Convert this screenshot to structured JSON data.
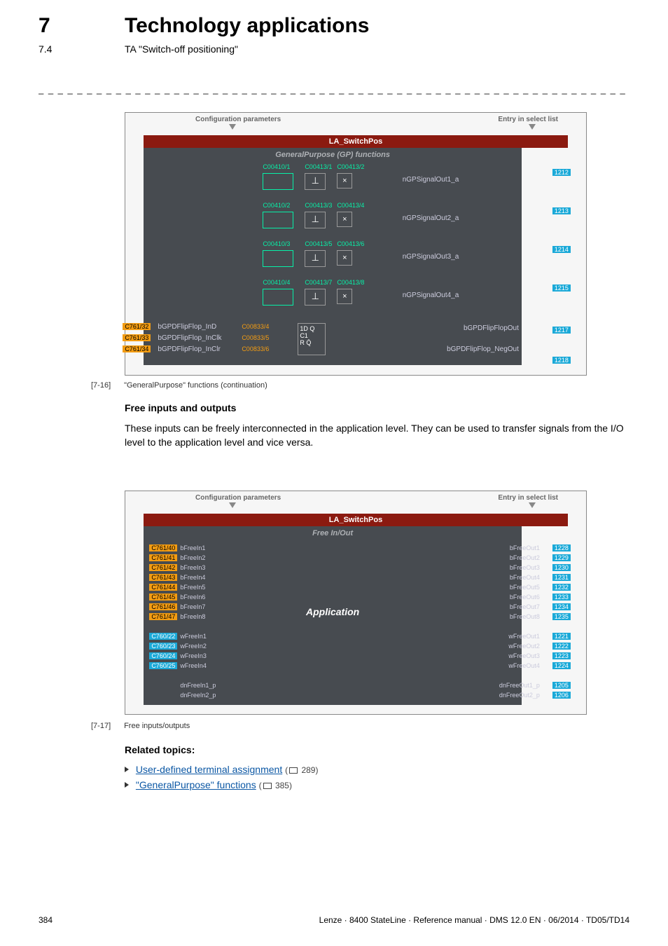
{
  "header": {
    "num": "7",
    "title": "Technology applications",
    "subnum": "7.4",
    "subtitle": "TA \"Switch-off positioning\""
  },
  "diag_common": {
    "cfg": "Configuration parameters",
    "entry": "Entry in select list",
    "la": "LA_SwitchPos"
  },
  "diag1": {
    "subheader": "GeneralPurpose (GP) functions",
    "rows": [
      {
        "c1": "C00410/1",
        "c2": "C00413/1",
        "c3": "C00413/2",
        "out": "nGPSignalOut1_a",
        "pin": "1212"
      },
      {
        "c1": "C00410/2",
        "c2": "C00413/3",
        "c3": "C00413/4",
        "out": "nGPSignalOut2_a",
        "pin": "1213"
      },
      {
        "c1": "C00410/3",
        "c2": "C00413/5",
        "c3": "C00413/6",
        "out": "nGPSignalOut3_a",
        "pin": "1214"
      },
      {
        "c1": "C00410/4",
        "c2": "C00413/7",
        "c3": "C00413/8",
        "out": "nGPSignalOut4_a",
        "pin": "1215"
      }
    ],
    "ff": {
      "in": [
        "bGPDFlipFlop_InD",
        "bGPDFlipFlop_InClk",
        "bGPDFlipFlop_InClr"
      ],
      "codes": [
        "C00833/4",
        "C00833/5",
        "C00833/6"
      ],
      "tags": [
        "C761/32",
        "C761/33",
        "C761/34"
      ],
      "box": [
        "1D  Q",
        "C1",
        "R   Q̄"
      ],
      "out": [
        "bGPDFlipFlopOut",
        "bGPDFlipFlop_NegOut"
      ],
      "pins": [
        "1217",
        "1218"
      ]
    }
  },
  "caption1": {
    "tag": "[7-16]",
    "text": "\"GeneralPurpose\" functions (continuation)"
  },
  "freeio": {
    "heading": "Free inputs and outputs",
    "para": "These inputs can be freely interconnected in the application level. They can be used to transfer signals from the I/O level to the application level and vice versa."
  },
  "diag2": {
    "subheader": "Free In/Out",
    "app": "Application",
    "bIn": [
      {
        "tag": "C761/40",
        "lbl": "bFreeIn1"
      },
      {
        "tag": "C761/41",
        "lbl": "bFreeIn2"
      },
      {
        "tag": "C761/42",
        "lbl": "bFreeIn3"
      },
      {
        "tag": "C761/43",
        "lbl": "bFreeIn4"
      },
      {
        "tag": "C761/44",
        "lbl": "bFreeIn5"
      },
      {
        "tag": "C761/45",
        "lbl": "bFreeIn6"
      },
      {
        "tag": "C761/46",
        "lbl": "bFreeIn7"
      },
      {
        "tag": "C761/47",
        "lbl": "bFreeIn8"
      }
    ],
    "wIn": [
      {
        "tag": "C760/22",
        "lbl": "wFreeIn1"
      },
      {
        "tag": "C760/23",
        "lbl": "wFreeIn2"
      },
      {
        "tag": "C760/24",
        "lbl": "wFreeIn3"
      },
      {
        "tag": "C760/25",
        "lbl": "wFreeIn4"
      }
    ],
    "dnIn": [
      {
        "lbl": "dnFreeIn1_p"
      },
      {
        "lbl": "dnFreeIn2_p"
      }
    ],
    "bOut": [
      {
        "lbl": "bFreeOut1",
        "pin": "1228"
      },
      {
        "lbl": "bFreeOut2",
        "pin": "1229"
      },
      {
        "lbl": "bFreeOut3",
        "pin": "1230"
      },
      {
        "lbl": "bFreeOut4",
        "pin": "1231"
      },
      {
        "lbl": "bFreeOut5",
        "pin": "1232"
      },
      {
        "lbl": "bFreeOut6",
        "pin": "1233"
      },
      {
        "lbl": "bFreeOut7",
        "pin": "1234"
      },
      {
        "lbl": "bFreeOut8",
        "pin": "1235"
      }
    ],
    "wOut": [
      {
        "lbl": "wFreeOut1",
        "pin": "1221"
      },
      {
        "lbl": "wFreeOut2",
        "pin": "1222"
      },
      {
        "lbl": "wFreeOut3",
        "pin": "1223"
      },
      {
        "lbl": "wFreeOut4",
        "pin": "1224"
      }
    ],
    "dnOut": [
      {
        "lbl": "dnFreeOut1_p",
        "pin": "1205"
      },
      {
        "lbl": "dnFreeOut2_p",
        "pin": "1206"
      }
    ]
  },
  "caption2": {
    "tag": "[7-17]",
    "text": "Free inputs/outputs"
  },
  "related": {
    "heading": "Related topics:",
    "l1_text": "User-defined terminal assignment",
    "l1_ref": "289",
    "l2_text": "\"GeneralPurpose\" functions",
    "l2_ref": "385"
  },
  "footer": {
    "page": "384",
    "meta": "Lenze · 8400 StateLine · Reference manual · DMS 12.0 EN · 06/2014 · TD05/TD14"
  }
}
